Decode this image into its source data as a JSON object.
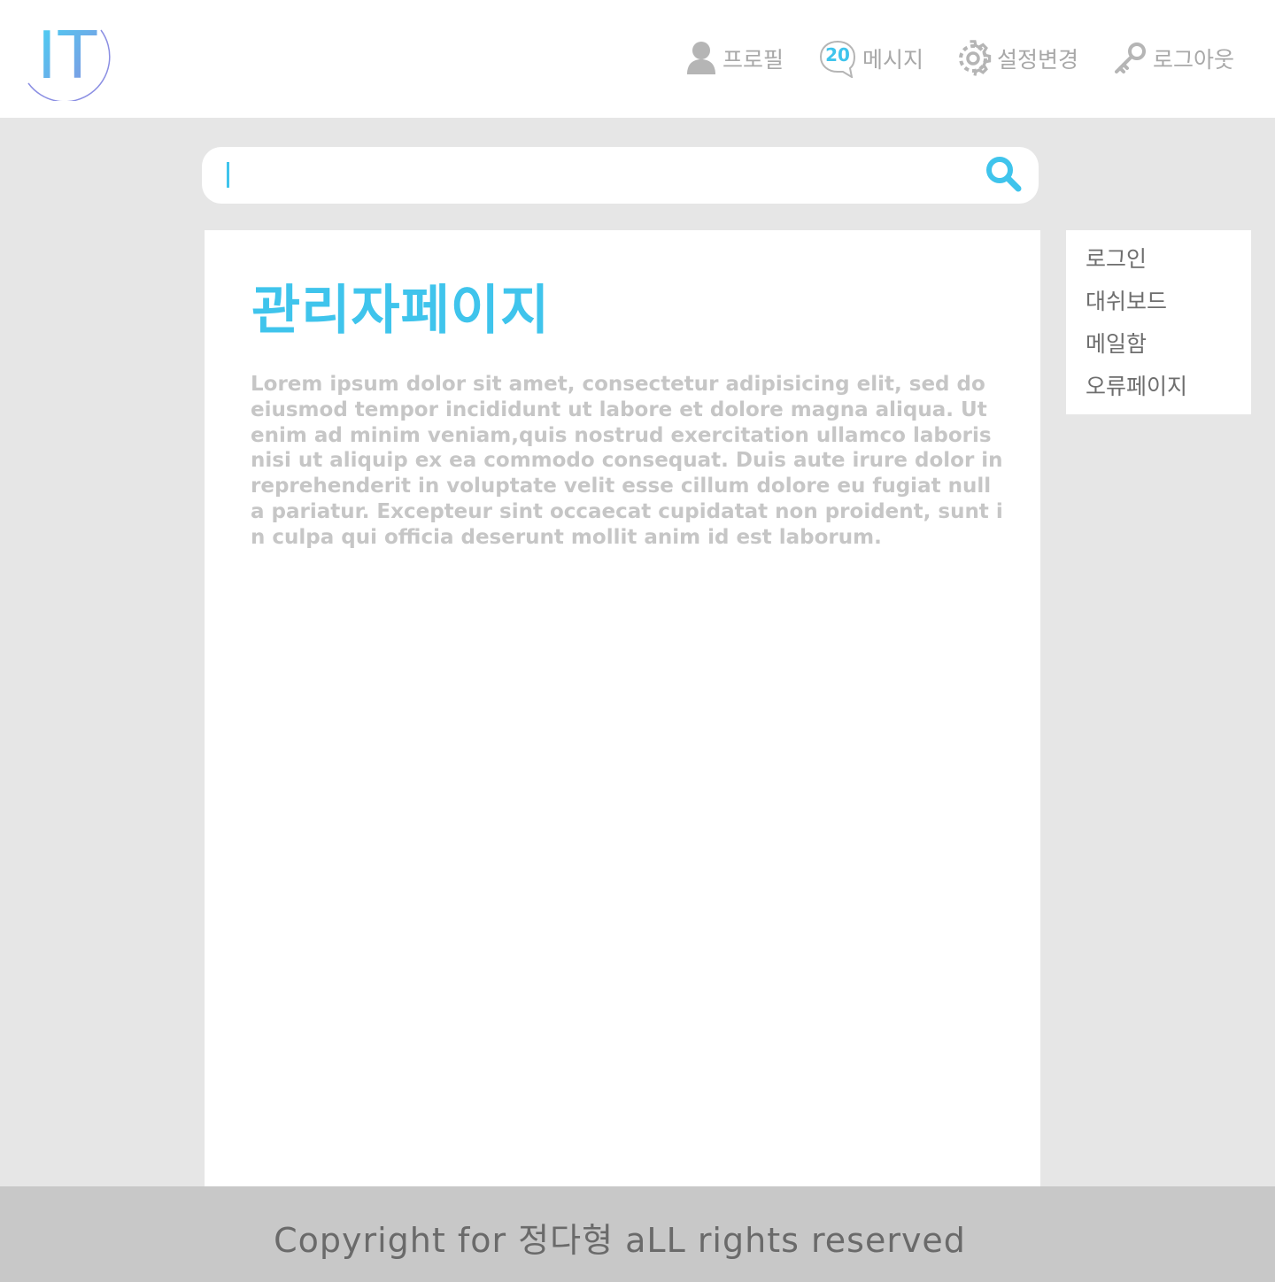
{
  "logo": {
    "text": "IT"
  },
  "nav": {
    "profile": "프로필",
    "message": "메시지",
    "message_count": "20",
    "settings": "설정변경",
    "logout": "로그아웃"
  },
  "search": {
    "placeholder": "",
    "value": ""
  },
  "main": {
    "title": "관리자페이지",
    "body": "Lorem ipsum dolor sit amet, consectetur adipisicing elit, sed do eiusmod tempor incididunt ut labore et dolore magna aliqua. Ut enim ad minim veniam,quis nostrud exercitation ullamco laboris nisi ut aliquip ex ea commodo consequat. Duis aute irure dolor in reprehenderit in voluptate velit esse cillum dolore eu fugiat nulla pariatur. Excepteur sint occaecat cupidatat non proident, sunt in culpa qui officia deserunt mollit anim id est laborum."
  },
  "side_menu": {
    "items": [
      {
        "label": "로그인"
      },
      {
        "label": "대쉬보드"
      },
      {
        "label": "메일함"
      },
      {
        "label": "오류페이지"
      }
    ]
  },
  "footer": {
    "text": "Copyright for 정다형 aLL rights reserved"
  },
  "colors": {
    "accent": "#3fc4ec",
    "nav_text": "#a8a8a8",
    "background": "#e6e6e6",
    "footer_bg": "#c8c8c8"
  },
  "icons": {
    "profile": "person-icon",
    "message": "speech-bubble-icon",
    "settings": "gear-icon",
    "logout": "key-icon",
    "search": "magnifier-icon"
  }
}
